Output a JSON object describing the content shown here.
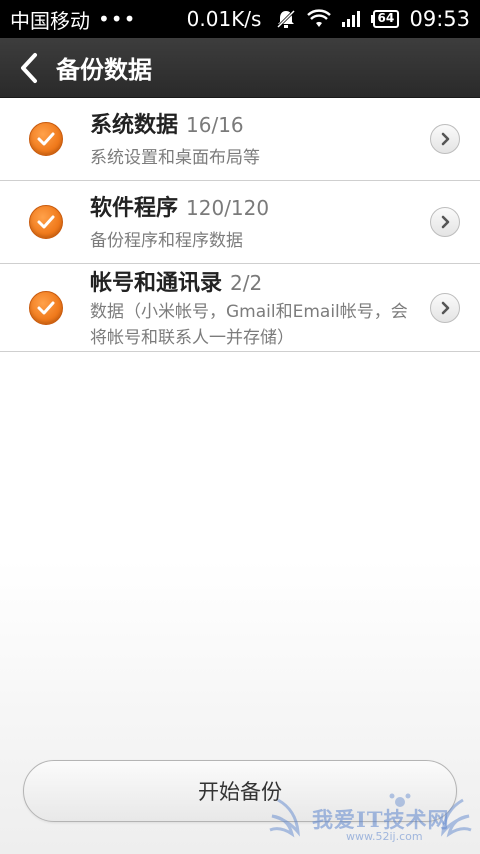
{
  "status_bar": {
    "carrier": "中国移动",
    "dots": "•••",
    "network_speed": "0.01K/s",
    "battery": "64",
    "time": "09:53",
    "icons": [
      "muted-bell-icon",
      "wifi-icon",
      "signal-icon",
      "battery-icon"
    ]
  },
  "header": {
    "title": "备份数据",
    "back_icon": "chevron-left-icon"
  },
  "items": [
    {
      "title": "系统数据",
      "count": "16/16",
      "subtitle": "系统设置和桌面布局等",
      "checked": true
    },
    {
      "title": "软件程序",
      "count": "120/120",
      "subtitle": "备份程序和程序数据",
      "checked": true
    },
    {
      "title": "帐号和通讯录",
      "count": "2/2",
      "subtitle": "数据（小米帐号，Gmail和Email帐号，会将帐号和联系人一并存储）",
      "checked": true
    }
  ],
  "start_button": {
    "label": "开始备份"
  },
  "watermark": {
    "text": "我爱IT技术网",
    "url": "www.52ij.com"
  },
  "colors": {
    "accent": "#f07a1c",
    "header_bg": "#333333",
    "status_bg": "#000000"
  }
}
